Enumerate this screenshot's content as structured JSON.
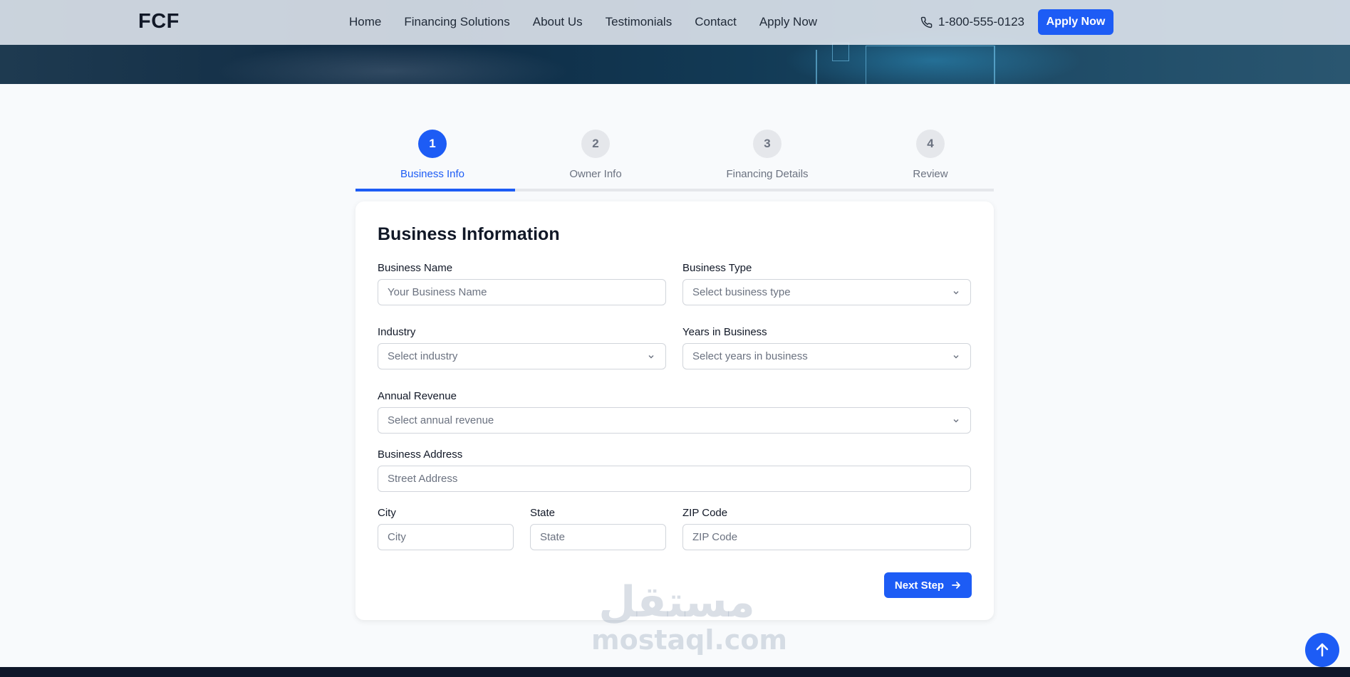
{
  "brand": {
    "logo_text": "FCF",
    "accent_color": "#1d5cf5"
  },
  "nav": {
    "links": [
      "Home",
      "Financing Solutions",
      "About Us",
      "Testimonials",
      "Contact",
      "Apply Now"
    ],
    "phone": "1-800-555-0123",
    "phone_icon": "phone-icon",
    "apply_button": "Apply Now"
  },
  "steps": {
    "items": [
      {
        "number": "1",
        "label": "Business Info",
        "state": "active"
      },
      {
        "number": "2",
        "label": "Owner Info",
        "state": "inactive"
      },
      {
        "number": "3",
        "label": "Financing Details",
        "state": "inactive"
      },
      {
        "number": "4",
        "label": "Review",
        "state": "inactive"
      }
    ],
    "progress_percent": 25
  },
  "form": {
    "title": "Business Information",
    "business_name": {
      "label": "Business Name",
      "placeholder": "Your Business Name",
      "value": ""
    },
    "business_type": {
      "label": "Business Type",
      "selected": "Select business type"
    },
    "industry": {
      "label": "Industry",
      "selected": "Select industry"
    },
    "years_in_business": {
      "label": "Years in Business",
      "selected": "Select years in business"
    },
    "annual_revenue": {
      "label": "Annual Revenue",
      "selected": "Select annual revenue"
    },
    "business_address": {
      "label": "Business Address",
      "placeholder": "Street Address",
      "value": ""
    },
    "city": {
      "label": "City",
      "placeholder": "City",
      "value": ""
    },
    "state": {
      "label": "State",
      "placeholder": "State",
      "value": ""
    },
    "zip": {
      "label": "ZIP Code",
      "placeholder": "ZIP Code",
      "value": ""
    },
    "next_button": "Next Step",
    "next_icon": "arrow-right-icon"
  },
  "watermark": {
    "arabic": "مستقل",
    "latin": "mostaql.com"
  },
  "scroll_top_icon": "arrow-up-icon"
}
